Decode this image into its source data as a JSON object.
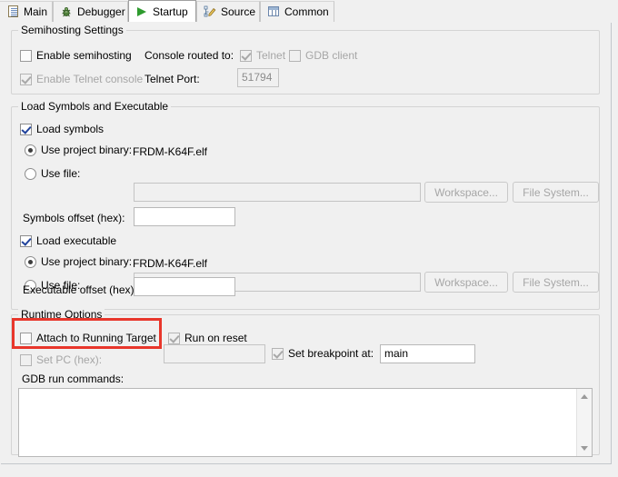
{
  "window": {
    "title": "Startup"
  },
  "tabs": [
    {
      "label": "Main",
      "icon": "file-icon",
      "active": false
    },
    {
      "label": "Debugger",
      "icon": "bug-icon",
      "active": false
    },
    {
      "label": "Startup",
      "icon": "play-icon",
      "active": true
    },
    {
      "label": "Source",
      "icon": "source-icon",
      "active": false
    },
    {
      "label": "Common",
      "icon": "table-icon",
      "active": false
    }
  ],
  "semihosting": {
    "group_label": "Semihosting Settings",
    "enable_semihosting": {
      "label": "Enable semihosting",
      "checked": false,
      "enabled": true
    },
    "enable_telnet_console": {
      "label": "Enable Telnet console",
      "checked": true,
      "enabled": false
    },
    "console_routed_to_label": "Console routed to:",
    "telnet": {
      "label": "Telnet",
      "checked": true,
      "enabled": false
    },
    "gdb_client": {
      "label": "GDB client",
      "checked": false,
      "enabled": false
    },
    "telnet_port_label": "Telnet Port:",
    "telnet_port_value": "51794"
  },
  "load_symbols": {
    "group_label": "Load Symbols and Executable",
    "load_symbols": {
      "label": "Load symbols",
      "checked": true
    },
    "symbols_use_project_binary": {
      "label": "Use project binary:",
      "selected": true
    },
    "symbols_project_binary_value": "FRDM-K64F.elf",
    "symbols_use_file": {
      "label": "Use file:",
      "selected": false
    },
    "symbols_use_file_value": "",
    "symbols_workspace_button": "Workspace...",
    "symbols_filesystem_button": "File System...",
    "symbols_offset_label": "Symbols offset (hex):",
    "symbols_offset_value": "",
    "load_executable": {
      "label": "Load executable",
      "checked": true
    },
    "exec_use_project_binary": {
      "label": "Use project binary:",
      "selected": true
    },
    "exec_project_binary_value": "FRDM-K64F.elf",
    "exec_use_file": {
      "label": "Use file:",
      "selected": false
    },
    "exec_use_file_value": "",
    "exec_workspace_button": "Workspace...",
    "exec_filesystem_button": "File System...",
    "exec_offset_label": "Executable offset (hex):",
    "exec_offset_value": ""
  },
  "runtime": {
    "group_label": "Runtime Options",
    "attach_to_running_target": {
      "label": "Attach to Running Target",
      "checked": false,
      "enabled": true
    },
    "run_on_reset": {
      "label": "Run on reset",
      "checked": true,
      "enabled": false
    },
    "set_pc": {
      "label": "Set PC (hex):",
      "checked": false,
      "enabled": false
    },
    "set_pc_value": "",
    "set_breakpoint_at": {
      "label": "Set breakpoint at:",
      "checked": true,
      "enabled": false
    },
    "set_breakpoint_value": "main",
    "gdb_run_commands_label": "GDB run commands:",
    "gdb_run_commands_value": ""
  },
  "annotation": {
    "color": "#e8362b",
    "target": "attach-to-running-target-checkbox"
  },
  "colors": {
    "background": "#f0f0f0",
    "field_background": "#ffffff",
    "border": "#d4d4d4",
    "disabled_text": "#a6a6a6",
    "accent_green": "#2e9b2e",
    "annotation_red": "#e8362b"
  }
}
